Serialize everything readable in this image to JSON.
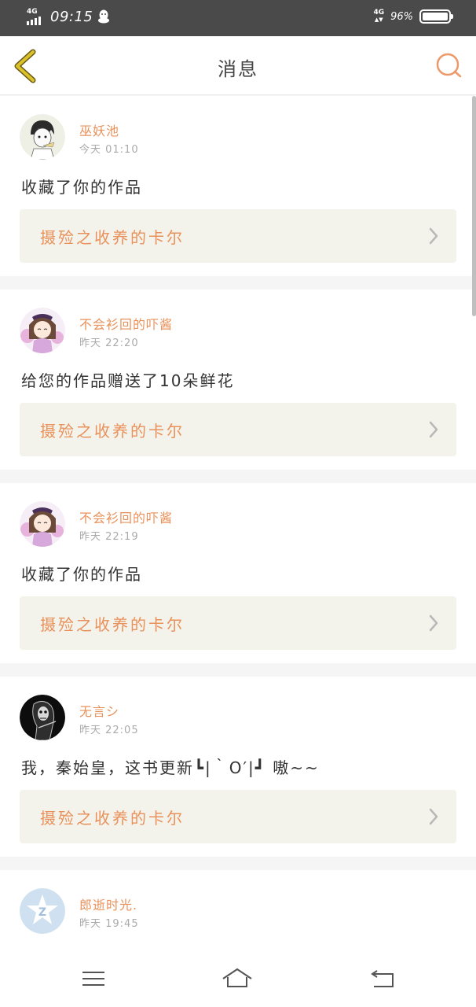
{
  "status_bar": {
    "network_left": "4G",
    "time": "09:15",
    "network_right": "4G",
    "battery_percent": "96%",
    "battery_level": 0.96,
    "icons": [
      "signal-icon",
      "qq-icon",
      "battery-icon"
    ]
  },
  "header": {
    "title": "消息",
    "back_icon": "chevron-left-icon",
    "search_icon": "search-icon",
    "accent_color": "#e9915a",
    "back_color": "#c8a91d"
  },
  "messages": [
    {
      "username": "巫妖池",
      "time": "今天 01:10",
      "text": "收藏了你的作品",
      "work_title": "摄殓之收养的卡尔",
      "avatar": "boy-sketch-avatar"
    },
    {
      "username": "不会衫回的吓酱",
      "time": "昨天 22:20",
      "text": "给您的作品赠送了10朵鲜花",
      "work_title": "摄殓之收养的卡尔",
      "avatar": "anime-girl-avatar"
    },
    {
      "username": "不会衫回的吓酱",
      "time": "昨天 22:19",
      "text": "收藏了你的作品",
      "work_title": "摄殓之收养的卡尔",
      "avatar": "anime-girl-avatar"
    },
    {
      "username": "无言シ",
      "time": "昨天 22:05",
      "text": "我，秦始皇，这书更新┗|｀O′|┛ 嗷~~",
      "work_title": "摄殓之收养的卡尔",
      "avatar": "reaper-avatar"
    },
    {
      "username": "郎逝时光.",
      "time": "昨天 19:45",
      "avatar": "default-qq-avatar"
    }
  ],
  "nav_bar": {
    "icons": [
      "menu-icon",
      "home-icon",
      "back-icon"
    ]
  }
}
